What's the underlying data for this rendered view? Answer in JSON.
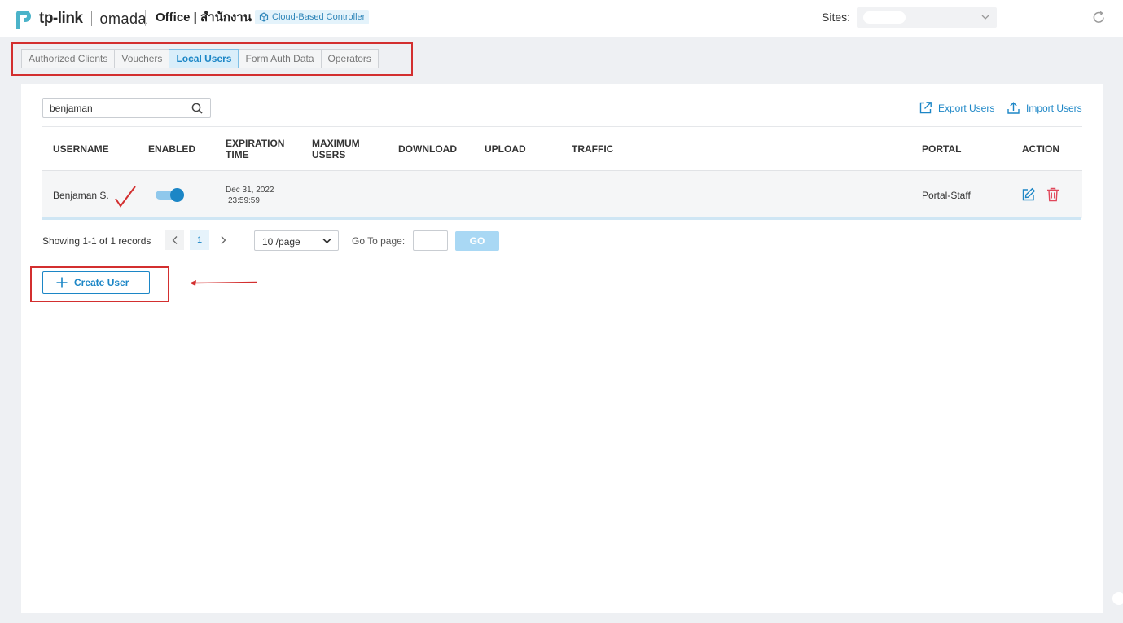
{
  "header": {
    "brand": "tp-link",
    "product": "omada",
    "site_title": "Office | สำนักงาน",
    "badge": "Cloud-Based Controller",
    "sites_label": "Sites:",
    "icons": [
      "tp-link-logo-icon",
      "cloud-controller-icon",
      "chevron-down-icon",
      "refresh-icon"
    ]
  },
  "tabs": [
    {
      "label": "Authorized Clients",
      "active": false
    },
    {
      "label": "Vouchers",
      "active": false
    },
    {
      "label": "Local Users",
      "active": true
    },
    {
      "label": "Form Auth Data",
      "active": false
    },
    {
      "label": "Operators",
      "active": false
    }
  ],
  "toolbar": {
    "search_value": "benjaman",
    "export_label": "Export Users",
    "import_label": "Import Users"
  },
  "table": {
    "columns": [
      {
        "line1": "USERNAME",
        "line2": ""
      },
      {
        "line1": "ENABLED",
        "line2": ""
      },
      {
        "line1": "EXPIRATION",
        "line2": "TIME"
      },
      {
        "line1": "MAXIMUM",
        "line2": "USERS"
      },
      {
        "line1": "DOWNLOAD",
        "line2": ""
      },
      {
        "line1": "UPLOAD",
        "line2": ""
      },
      {
        "line1": "TRAFFIC",
        "line2": ""
      },
      {
        "line1": "PORTAL",
        "line2": ""
      },
      {
        "line1": "ACTION",
        "line2": ""
      }
    ],
    "rows": [
      {
        "username": "Benjaman S.",
        "enabled": true,
        "expiration_date": "Dec 31, 2022",
        "expiration_time": "23:59:59",
        "portal": "Portal-Staff"
      }
    ]
  },
  "pagination": {
    "showing": "Showing 1-1 of 1 records",
    "current_page": "1",
    "per_page": "10 /page",
    "goto_label": "Go To page:",
    "go_label": "GO"
  },
  "create_user_label": "Create User",
  "colors": {
    "accent": "#1c86c6",
    "annotation_red": "#d32f2f",
    "delete_red": "#e0475a"
  }
}
